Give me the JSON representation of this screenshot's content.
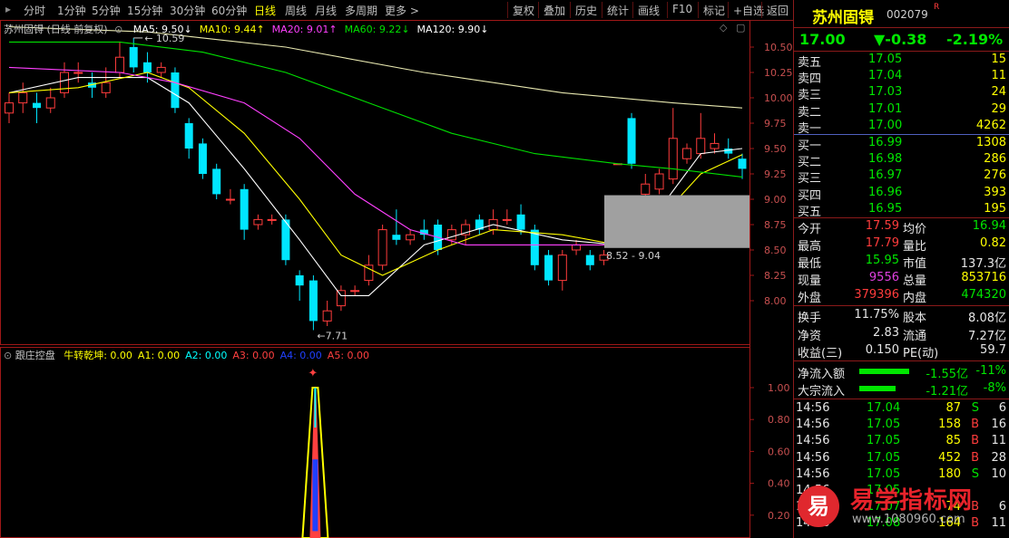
{
  "toolbar": {
    "period_tabs": [
      "分时",
      "1分钟",
      "5分钟",
      "15分钟",
      "30分钟",
      "60分钟",
      "日线",
      "周线",
      "月线",
      "多周期",
      "更多 >"
    ],
    "active_tab": "日线",
    "right_buttons": [
      "复权",
      "叠加",
      "历史",
      "统计",
      "画线",
      "F10",
      "标记",
      "+自选",
      "返回"
    ]
  },
  "main_chart": {
    "title": "苏州固锝 (日线 前复权)",
    "ma_legend": [
      {
        "label": "MA5: 9.50↓",
        "color": "#ffffff"
      },
      {
        "label": "MA10: 9.44↑",
        "color": "#ffff00"
      },
      {
        "label": "MA20: 9.01↑",
        "color": "#ff40ff"
      },
      {
        "label": "MA60: 9.22↓",
        "color": "#00e000"
      },
      {
        "label": "MA120: 9.90↓",
        "color": "#ffffff"
      }
    ],
    "high_mark": "10.59",
    "low_mark": "7.71",
    "range_label": "8.52 - 9.04",
    "price_axis": [
      "10.50",
      "10.25",
      "10.00",
      "9.75",
      "9.50",
      "9.25",
      "9.00",
      "8.75",
      "8.50",
      "8.25",
      "8.00"
    ]
  },
  "sub_chart": {
    "title": "跟庄控盘",
    "indicators": [
      {
        "label": "牛转乾坤: 0.00",
        "color": "#ffff00"
      },
      {
        "label": "A1: 0.00",
        "color": "#ffff00"
      },
      {
        "label": "A2: 0.00",
        "color": "#00ffff"
      },
      {
        "label": "A3: 0.00",
        "color": "#ff4040"
      },
      {
        "label": "A4: 0.00",
        "color": "#2040ff"
      },
      {
        "label": "A5: 0.00",
        "color": "#ff4040"
      }
    ],
    "axis": [
      "1.00",
      "0.80",
      "0.60",
      "0.40",
      "0.20"
    ]
  },
  "chart_data": {
    "type": "candlestick",
    "title": "苏州固锝 (日线 前复权)",
    "ylim": [
      7.6,
      10.75
    ],
    "candles": [
      {
        "o": 9.85,
        "c": 9.95,
        "h": 10.05,
        "l": 9.75
      },
      {
        "o": 9.95,
        "c": 10.05,
        "h": 10.15,
        "l": 9.85
      },
      {
        "o": 9.95,
        "c": 9.9,
        "h": 10.05,
        "l": 9.75
      },
      {
        "o": 9.9,
        "c": 10.0,
        "h": 10.1,
        "l": 9.85
      },
      {
        "o": 10.05,
        "c": 10.25,
        "h": 10.35,
        "l": 10.0
      },
      {
        "o": 10.25,
        "c": 10.25,
        "h": 10.35,
        "l": 10.15
      },
      {
        "o": 10.15,
        "c": 10.1,
        "h": 10.25,
        "l": 10.0
      },
      {
        "o": 10.05,
        "c": 10.15,
        "h": 10.3,
        "l": 10.0
      },
      {
        "o": 10.25,
        "c": 10.4,
        "h": 10.55,
        "l": 10.2
      },
      {
        "o": 10.5,
        "c": 10.3,
        "h": 10.59,
        "l": 10.25
      },
      {
        "o": 10.35,
        "c": 10.25,
        "h": 10.45,
        "l": 10.15
      },
      {
        "o": 10.25,
        "c": 10.3,
        "h": 10.35,
        "l": 10.2
      },
      {
        "o": 10.25,
        "c": 9.9,
        "h": 10.3,
        "l": 9.85
      },
      {
        "o": 9.75,
        "c": 9.5,
        "h": 9.8,
        "l": 9.4
      },
      {
        "o": 9.55,
        "c": 9.25,
        "h": 9.6,
        "l": 9.2
      },
      {
        "o": 9.3,
        "c": 9.05,
        "h": 9.35,
        "l": 9.0
      },
      {
        "o": 9.0,
        "c": 9.0,
        "h": 9.1,
        "l": 8.95
      },
      {
        "o": 9.1,
        "c": 8.7,
        "h": 9.15,
        "l": 8.6
      },
      {
        "o": 8.75,
        "c": 8.8,
        "h": 8.85,
        "l": 8.7
      },
      {
        "o": 8.8,
        "c": 8.8,
        "h": 8.85,
        "l": 8.75
      },
      {
        "o": 8.8,
        "c": 8.4,
        "h": 8.85,
        "l": 8.35
      },
      {
        "o": 8.25,
        "c": 8.15,
        "h": 8.3,
        "l": 8.0
      },
      {
        "o": 8.2,
        "c": 7.8,
        "h": 8.25,
        "l": 7.71
      },
      {
        "o": 7.8,
        "c": 7.9,
        "h": 8.0,
        "l": 7.75
      },
      {
        "o": 7.95,
        "c": 8.1,
        "h": 8.15,
        "l": 7.9
      },
      {
        "o": 8.1,
        "c": 8.1,
        "h": 8.15,
        "l": 8.05
      },
      {
        "o": 8.2,
        "c": 8.35,
        "h": 8.45,
        "l": 8.15
      },
      {
        "o": 8.35,
        "c": 8.7,
        "h": 8.75,
        "l": 8.3
      },
      {
        "o": 8.65,
        "c": 8.6,
        "h": 8.9,
        "l": 8.55
      },
      {
        "o": 8.6,
        "c": 8.65,
        "h": 8.7,
        "l": 8.55
      },
      {
        "o": 8.7,
        "c": 8.65,
        "h": 8.8,
        "l": 8.6
      },
      {
        "o": 8.75,
        "c": 8.5,
        "h": 8.8,
        "l": 8.45
      },
      {
        "o": 8.6,
        "c": 8.7,
        "h": 8.75,
        "l": 8.55
      },
      {
        "o": 8.65,
        "c": 8.75,
        "h": 8.8,
        "l": 8.55
      },
      {
        "o": 8.8,
        "c": 8.7,
        "h": 8.85,
        "l": 8.65
      },
      {
        "o": 8.7,
        "c": 8.8,
        "h": 8.9,
        "l": 8.65
      },
      {
        "o": 8.8,
        "c": 8.8,
        "h": 8.9,
        "l": 8.75
      },
      {
        "o": 8.85,
        "c": 8.7,
        "h": 8.95,
        "l": 8.65
      },
      {
        "o": 8.7,
        "c": 8.35,
        "h": 8.75,
        "l": 8.3
      },
      {
        "o": 8.45,
        "c": 8.2,
        "h": 8.5,
        "l": 8.15
      },
      {
        "o": 8.2,
        "c": 8.45,
        "h": 8.5,
        "l": 8.1
      },
      {
        "o": 8.5,
        "c": 8.55,
        "h": 8.6,
        "l": 8.45
      },
      {
        "o": 8.45,
        "c": 8.35,
        "h": 8.5,
        "l": 8.3
      },
      {
        "o": 8.4,
        "c": 8.45,
        "h": 8.5,
        "l": 8.35
      },
      {
        "o": 9.35,
        "c": 9.35,
        "h": 9.35,
        "l": 9.35
      },
      {
        "o": 9.8,
        "c": 9.35,
        "h": 9.85,
        "l": 9.3
      },
      {
        "o": 9.05,
        "c": 9.15,
        "h": 9.25,
        "l": 9.0
      },
      {
        "o": 9.1,
        "c": 9.25,
        "h": 9.3,
        "l": 9.05
      },
      {
        "o": 9.2,
        "c": 9.6,
        "h": 9.9,
        "l": 9.15
      },
      {
        "o": 9.4,
        "c": 9.5,
        "h": 9.55,
        "l": 9.35
      },
      {
        "o": 9.45,
        "c": 9.6,
        "h": 9.85,
        "l": 9.4
      },
      {
        "o": 9.5,
        "c": 9.55,
        "h": 9.65,
        "l": 9.45
      },
      {
        "o": 9.5,
        "c": 9.45,
        "h": 9.6,
        "l": 9.4
      },
      {
        "o": 9.4,
        "c": 9.3,
        "h": 9.45,
        "l": 9.2
      }
    ],
    "ma_series": [
      {
        "name": "MA5",
        "color": "#ffffff",
        "points": [
          [
            0,
            10.05
          ],
          [
            5,
            10.2
          ],
          [
            10,
            10.2
          ],
          [
            13,
            9.95
          ],
          [
            17,
            9.3
          ],
          [
            21,
            8.6
          ],
          [
            24,
            8.05
          ],
          [
            26,
            8.05
          ],
          [
            30,
            8.55
          ],
          [
            35,
            8.75
          ],
          [
            40,
            8.6
          ],
          [
            44,
            8.55
          ],
          [
            47,
            8.9
          ],
          [
            50,
            9.45
          ],
          [
            53,
            9.5
          ]
        ]
      },
      {
        "name": "MA10",
        "color": "#ffff00",
        "points": [
          [
            0,
            10.05
          ],
          [
            5,
            10.1
          ],
          [
            10,
            10.25
          ],
          [
            13,
            10.1
          ],
          [
            17,
            9.65
          ],
          [
            21,
            9.0
          ],
          [
            24,
            8.45
          ],
          [
            27,
            8.25
          ],
          [
            31,
            8.5
          ],
          [
            35,
            8.7
          ],
          [
            40,
            8.65
          ],
          [
            44,
            8.55
          ],
          [
            47,
            8.8
          ],
          [
            50,
            9.25
          ],
          [
            53,
            9.44
          ]
        ]
      },
      {
        "name": "MA20",
        "color": "#ff40ff",
        "points": [
          [
            0,
            10.3
          ],
          [
            8,
            10.25
          ],
          [
            12,
            10.15
          ],
          [
            17,
            9.95
          ],
          [
            21,
            9.6
          ],
          [
            25,
            9.05
          ],
          [
            29,
            8.7
          ],
          [
            33,
            8.55
          ],
          [
            38,
            8.55
          ],
          [
            43,
            8.55
          ],
          [
            47,
            8.75
          ],
          [
            50,
            8.9
          ],
          [
            53,
            9.01
          ]
        ]
      },
      {
        "name": "MA60",
        "color": "#00e000",
        "points": [
          [
            0,
            10.55
          ],
          [
            8,
            10.55
          ],
          [
            14,
            10.45
          ],
          [
            20,
            10.25
          ],
          [
            26,
            9.95
          ],
          [
            32,
            9.65
          ],
          [
            38,
            9.45
          ],
          [
            44,
            9.35
          ],
          [
            48,
            9.3
          ],
          [
            53,
            9.22
          ]
        ]
      },
      {
        "name": "MA120",
        "color": "#ffffff",
        "points": [
          [
            0,
            10.7
          ],
          [
            10,
            10.65
          ],
          [
            20,
            10.5
          ],
          [
            30,
            10.25
          ],
          [
            40,
            10.05
          ],
          [
            48,
            9.95
          ],
          [
            53,
            9.9
          ]
        ]
      }
    ],
    "sub_peak": {
      "x": 22,
      "value": 1.0
    }
  },
  "quote": {
    "name": "苏州固锝",
    "code": "002079",
    "flag": "R",
    "price": "17.00",
    "change": "▼-0.38",
    "change_pct": "-2.19%",
    "asks": [
      {
        "label": "卖五",
        "price": "17.05",
        "vol": "15"
      },
      {
        "label": "卖四",
        "price": "17.04",
        "vol": "11"
      },
      {
        "label": "卖三",
        "price": "17.03",
        "vol": "24"
      },
      {
        "label": "卖二",
        "price": "17.01",
        "vol": "29"
      },
      {
        "label": "卖一",
        "price": "17.00",
        "vol": "4262"
      }
    ],
    "bids": [
      {
        "label": "买一",
        "price": "16.99",
        "vol": "1308"
      },
      {
        "label": "买二",
        "price": "16.98",
        "vol": "286"
      },
      {
        "label": "买三",
        "price": "16.97",
        "vol": "276"
      },
      {
        "label": "买四",
        "price": "16.96",
        "vol": "393"
      },
      {
        "label": "买五",
        "price": "16.95",
        "vol": "195"
      }
    ],
    "stats": [
      {
        "k1": "今开",
        "v1": "17.59",
        "c1": "up",
        "k2": "均价",
        "v2": "16.94",
        "c2": "dn"
      },
      {
        "k1": "最高",
        "v1": "17.79",
        "c1": "up",
        "k2": "量比",
        "v2": "0.82",
        "c2": "ye"
      },
      {
        "k1": "最低",
        "v1": "15.95",
        "c1": "dn",
        "k2": "市值",
        "v2": "137.3亿",
        "c2": "wh"
      },
      {
        "k1": "现量",
        "v1": "9556",
        "c1": "mg",
        "k2": "总量",
        "v2": "853716",
        "c2": "ye"
      },
      {
        "k1": "外盘",
        "v1": "379396",
        "c1": "up",
        "k2": "内盘",
        "v2": "474320",
        "c2": "dn"
      }
    ],
    "stats2": [
      {
        "k1": "换手",
        "v1": "11.75%",
        "k2": "股本",
        "v2": "8.08亿"
      },
      {
        "k1": "净资",
        "v1": "2.83",
        "k2": "流通",
        "v2": "7.27亿"
      },
      {
        "k1": "收益(三)",
        "v1": "0.150",
        "k2": "PE(动)",
        "v2": "59.7"
      }
    ],
    "flows": [
      {
        "label": "净流入额",
        "value": "-1.55亿",
        "pct": "-11%",
        "bar": 0.55
      },
      {
        "label": "大宗流入",
        "value": "-1.21亿",
        "pct": "-8%",
        "bar": 0.4
      }
    ],
    "ticks": [
      {
        "time": "14:56",
        "price": "17.04",
        "vol": "87",
        "side": "S",
        "n": "6"
      },
      {
        "time": "14:56",
        "price": "17.05",
        "vol": "158",
        "side": "B",
        "n": "16"
      },
      {
        "time": "14:56",
        "price": "17.05",
        "vol": "85",
        "side": "B",
        "n": "11"
      },
      {
        "time": "14:56",
        "price": "17.05",
        "vol": "452",
        "side": "B",
        "n": "28"
      },
      {
        "time": "14:56",
        "price": "17.05",
        "vol": "180",
        "side": "S",
        "n": "10"
      },
      {
        "time": "14:56",
        "price": "17.05",
        "vol": "",
        "side": "",
        "n": ""
      },
      {
        "time": "14:56",
        "price": "17.07",
        "vol": "74",
        "side": "B",
        "n": "6"
      },
      {
        "time": "14:56",
        "price": "17.08",
        "vol": "164",
        "side": "B",
        "n": "11"
      }
    ]
  },
  "watermark": {
    "badge": "易",
    "title": "易学指标网",
    "url": "www.1080960.com"
  }
}
